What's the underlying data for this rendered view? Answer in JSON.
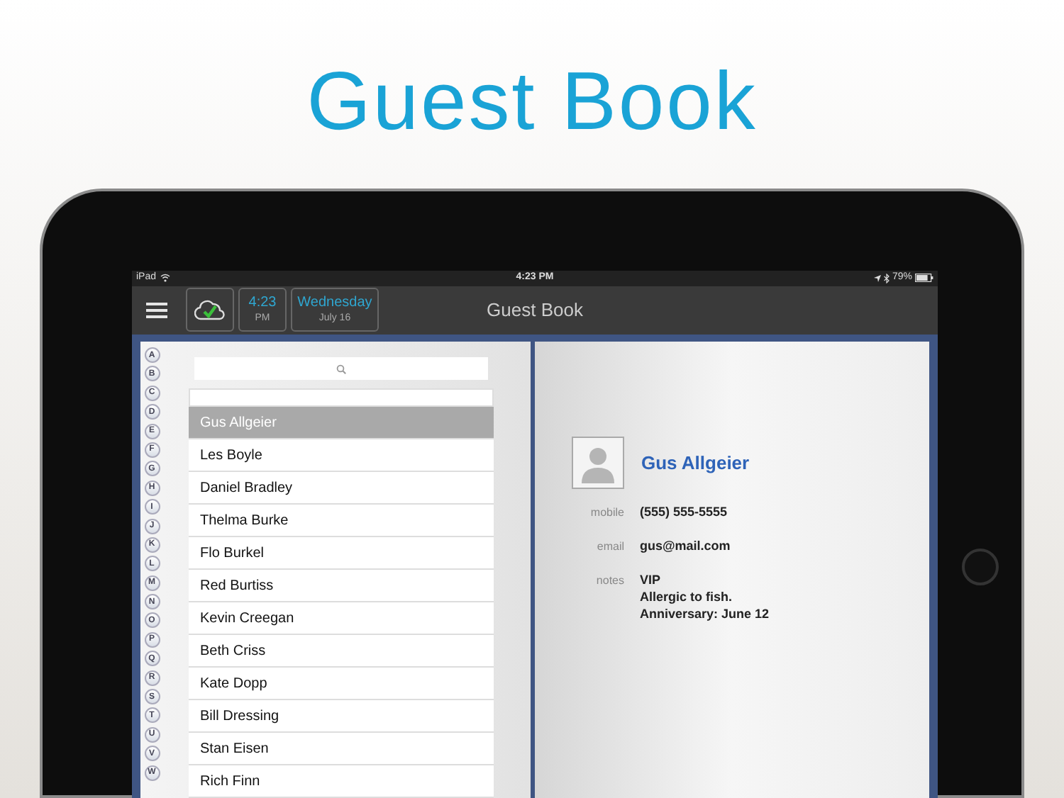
{
  "headline": "Guest Book",
  "status_bar": {
    "carrier": "iPad",
    "time": "4:23 PM",
    "battery": "79%"
  },
  "nav_bar": {
    "time": "4:23",
    "meridiem": "PM",
    "weekday": "Wednesday",
    "date": "July 16",
    "title": "Guest Book"
  },
  "index_letters": [
    "A",
    "B",
    "C",
    "D",
    "E",
    "F",
    "G",
    "H",
    "I",
    "J",
    "K",
    "L",
    "M",
    "N",
    "O",
    "P",
    "Q",
    "R",
    "S",
    "T",
    "U",
    "V",
    "W"
  ],
  "guests": [
    {
      "name": "Gus Allgeier",
      "selected": true
    },
    {
      "name": "Les Boyle",
      "selected": false
    },
    {
      "name": "Daniel Bradley",
      "selected": false
    },
    {
      "name": "Thelma Burke",
      "selected": false
    },
    {
      "name": "Flo Burkel",
      "selected": false
    },
    {
      "name": "Red Burtiss",
      "selected": false
    },
    {
      "name": "Kevin Creegan",
      "selected": false
    },
    {
      "name": "Beth Criss",
      "selected": false
    },
    {
      "name": "Kate Dopp",
      "selected": false
    },
    {
      "name": "Bill Dressing",
      "selected": false
    },
    {
      "name": "Stan Eisen",
      "selected": false
    },
    {
      "name": "Rich Finn",
      "selected": false
    }
  ],
  "contact": {
    "name": "Gus Allgeier",
    "fields": [
      {
        "label": "mobile",
        "lines": [
          "(555) 555-5555"
        ]
      },
      {
        "label": "email",
        "lines": [
          "gus@mail.com"
        ]
      },
      {
        "label": "notes",
        "lines": [
          "VIP",
          "Allergic to fish.",
          "Anniversary: June 12"
        ]
      }
    ]
  }
}
